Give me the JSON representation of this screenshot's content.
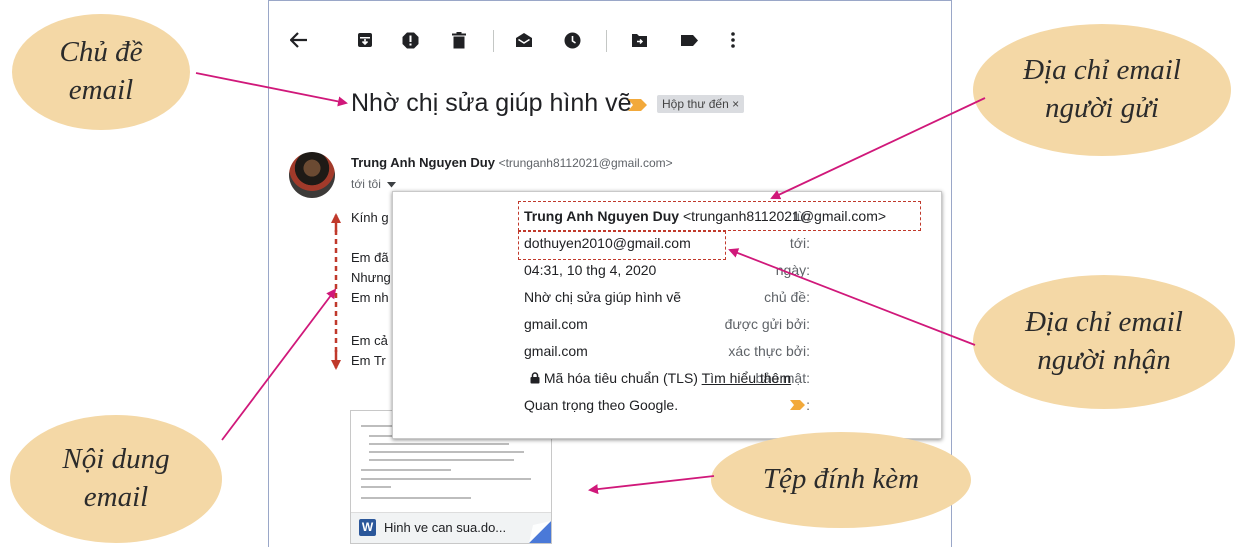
{
  "email": {
    "subject": "Nhờ chị sửa giúp hình vẽ",
    "inbox_label": "Hộp thư đến",
    "label_close": "×",
    "sender_name": "Trung Anh Nguyen Duy",
    "sender_address": "<trunganh8112021@gmail.com>",
    "recipient_line": "tới tôi",
    "body_lines": [
      "Kính g",
      "Em đã",
      "Nhưng",
      "Em nh",
      "Em cả",
      "Em Tr"
    ]
  },
  "toolbar": {
    "icons": [
      "back-arrow-icon",
      "archive-icon",
      "report-spam-icon",
      "delete-icon",
      "mark-unread-icon",
      "snooze-icon",
      "move-to-icon",
      "label-icon",
      "more-options-icon"
    ]
  },
  "details": {
    "rows": [
      {
        "label": "từ:",
        "value_bold": "Trung Anh Nguyen Duy",
        "value": "<trunganh8112021@gmail.com>"
      },
      {
        "label": "tới:",
        "value": "dothuyen2010@gmail.com"
      },
      {
        "label": "ngày:",
        "value": "04:31, 10 thg 4, 2020"
      },
      {
        "label": "chủ đề:",
        "value": "Nhờ chị sửa giúp hình vẽ"
      },
      {
        "label": "được gửi bởi:",
        "value": "gmail.com"
      },
      {
        "label": "xác thực bởi:",
        "value": "gmail.com"
      },
      {
        "label": "bảo mật:",
        "value": "Mã hóa tiêu chuẩn (TLS)",
        "link": "Tìm hiểu thêm"
      },
      {
        "label": ":",
        "value": "Quan trọng theo Google."
      }
    ]
  },
  "attachment": {
    "file_name": "Hinh ve can sua.do...",
    "file_type_letter": "W"
  },
  "annotations": {
    "subject_line1": "Chủ đề",
    "subject_line2": "email",
    "sender_line1": "Địa chỉ email",
    "sender_line2": "người gửi",
    "recipient_line1": "Địa chỉ email",
    "recipient_line2": "người nhận",
    "content_line1": "Nội dung",
    "content_line2": "email",
    "attachment_label": "Tệp đính kèm"
  },
  "colors": {
    "bubble": "#f4d8a6",
    "arrow": "#d0187a",
    "dashed_box": "#c0392b",
    "importance_marker": "#f2a93b"
  }
}
